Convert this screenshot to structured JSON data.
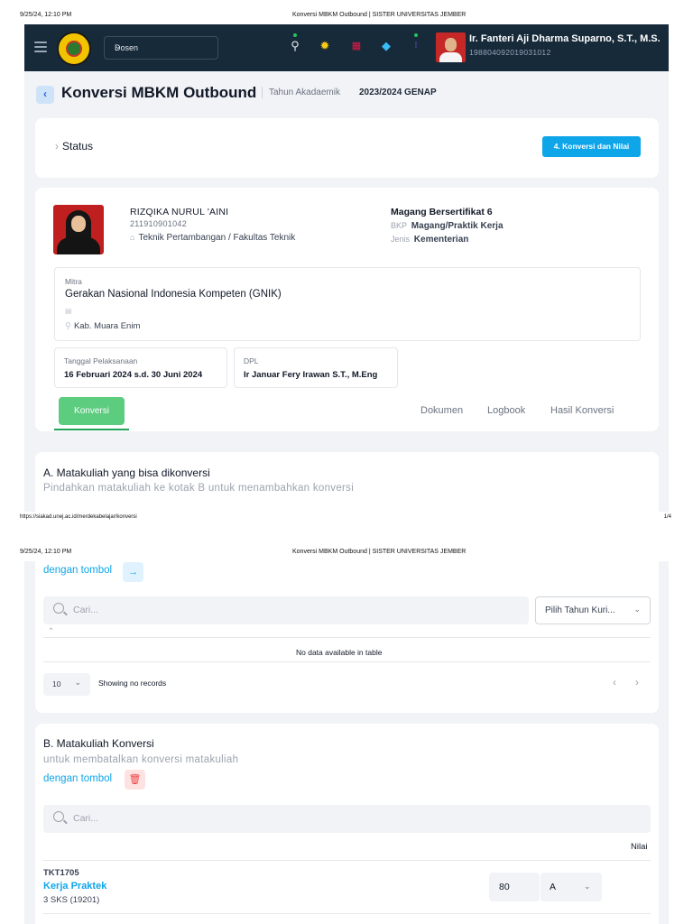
{
  "print": {
    "datetime": "9/25/24, 12:10 PM",
    "doc_title": "Konversi MBKM Outbound | SISTER UNIVERSITAS JEMBER",
    "url": "https://siakad.unej.ac.id/merdekabelajar/konversi",
    "page": "1/4"
  },
  "nav": {
    "role": "Dosen",
    "user_name": "Ir. Fanteri Aji Dharma Suparno, S.T., M.S.",
    "user_nip": "198804092019031012"
  },
  "header": {
    "title": "Konversi MBKM Outbound",
    "year_label": "Tahun Akadaemik",
    "year_value": "2023/2024 GENAP"
  },
  "status_card": {
    "label": "Status",
    "button": "4. Konversi dan Nilai"
  },
  "student": {
    "name": "RIZQIKA NURUL 'AINI",
    "nim": "211910901042",
    "prodi": "Teknik Pertambangan / Fakultas Teknik",
    "program": "Magang Bersertifikat 6",
    "bkp_label": "BKP",
    "bkp_value": "Magang/Praktik Kerja",
    "jenis_label": "Jenis",
    "jenis_value": "Kementerian"
  },
  "mitra": {
    "label": "Mitra",
    "name": "Gerakan Nasional Indonesia Kompeten (GNIK)",
    "location": "Kab. Muara Enim"
  },
  "pelaksanaan": {
    "label": "Tanggal Pelaksanaan",
    "value": "16 Februari 2024 s.d. 30 Juni 2024"
  },
  "dpl": {
    "label": "DPL",
    "value": "Ir Januar Fery Irawan S.T., M.Eng"
  },
  "tabs": [
    "Konversi",
    "Dokumen",
    "Logbook",
    "Hasil Konversi"
  ],
  "section_a": {
    "title": "A. Matakuliah yang bisa dikonversi",
    "subtitle": "Pindahkan matakuliah ke kotak B untuk menambahkan konversi",
    "link": "dengan tombol",
    "search_placeholder": "Cari...",
    "year_filter": "Pilih Tahun Kuri...",
    "empty": "No data available in table",
    "page_size": "10",
    "records": "Showing no records"
  },
  "section_b": {
    "title": "B. Matakuliah Konversi",
    "subtitle": "untuk membatalkan konversi matakuliah",
    "link": "dengan tombol",
    "search_placeholder": "Cari...",
    "col_nilai": "Nilai",
    "rows": [
      {
        "code": "TKT1705",
        "name": "Kerja Praktek",
        "sks": "3 SKS (19201)",
        "score": "80",
        "grade": "A"
      }
    ]
  },
  "colors": {
    "nav_bg": "#172a3a",
    "primary_blue": "#0ea5e9",
    "tab_green": "#5ccc7f",
    "delete_red": "#ef4444"
  }
}
